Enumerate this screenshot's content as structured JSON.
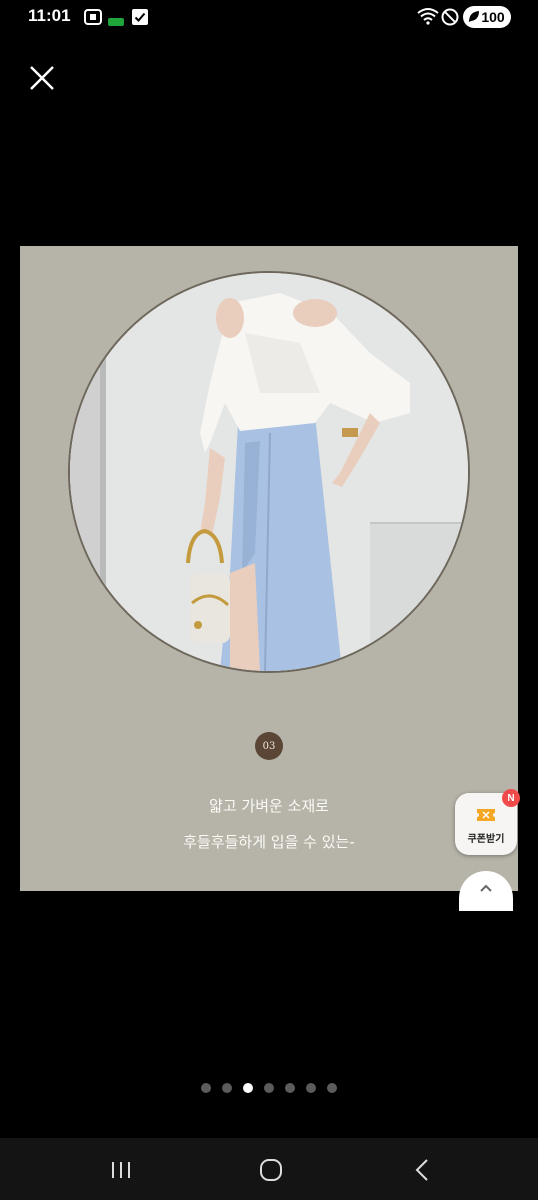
{
  "status_bar": {
    "time": "11:01",
    "battery": "100",
    "icons": [
      "screenshot-icon",
      "data-saver-icon",
      "checkbox-icon",
      "wifi-icon",
      "do-not-disturb-icon",
      "battery-icon"
    ]
  },
  "viewer": {
    "close_icon": "close-icon",
    "image": {
      "step_number": "03",
      "caption_line1": "얇고 가벼운 소재로",
      "caption_line2": "후들후들하게 입을 수 있는-"
    },
    "page_indicator": {
      "total": 7,
      "current": 3
    }
  },
  "floating": {
    "coupon_label": "쿠폰받기",
    "coupon_badge": "N"
  },
  "nav_bar": {
    "buttons": [
      "recent-apps-icon",
      "home-icon",
      "back-icon"
    ]
  },
  "colors": {
    "image_bg": "#b6b3a8",
    "badge_bg": "#5b4636",
    "coupon_badge": "#f04a4a"
  }
}
